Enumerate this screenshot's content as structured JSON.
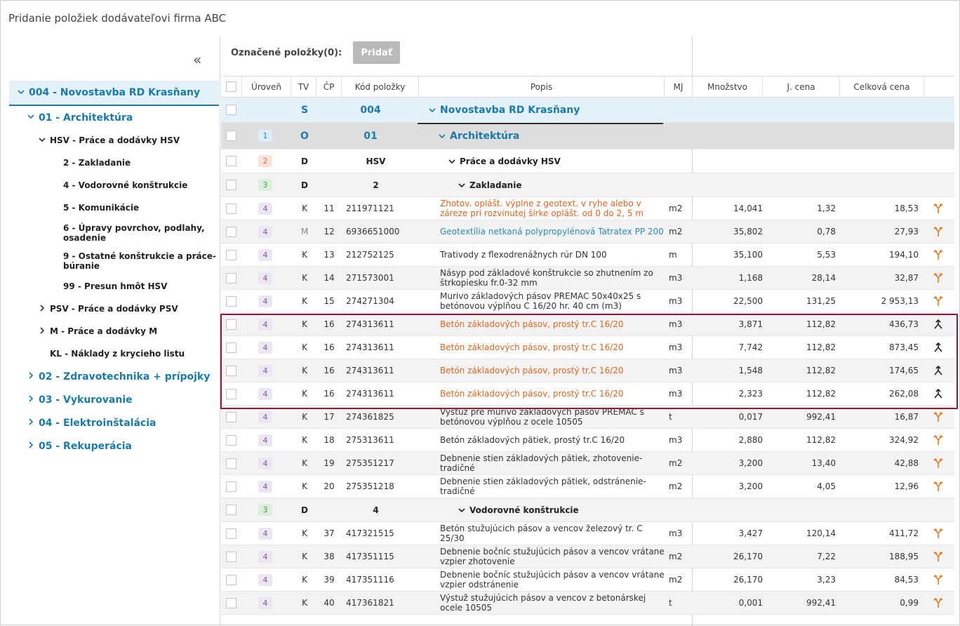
{
  "window_title": "Pridanie položiek dodávateľovi firma ABC",
  "sidebar": {
    "collapse_glyph": "«",
    "tree": [
      {
        "label": "004 - Novostavba RD Krasňany",
        "level": 0,
        "chev": "down"
      },
      {
        "label": "01 - Architektúra",
        "level": 1,
        "chev": "down"
      },
      {
        "label": "HSV - Práce a dodávky HSV",
        "level": 2,
        "chev": "down"
      },
      {
        "label": "2 - Zakladanie",
        "level": 3
      },
      {
        "label": "4 - Vodorovné konštrukcie",
        "level": 3
      },
      {
        "label": "5 - Komunikácie",
        "level": 3
      },
      {
        "label": "6 - Úpravy povrchov, podlahy, osadenie",
        "level": 3,
        "tall": true
      },
      {
        "label": "9 - Ostatné konštrukcie a práce-búranie",
        "level": 3,
        "tall": true
      },
      {
        "label": "99 - Presun hmôt HSV",
        "level": 3
      },
      {
        "label": "PSV - Práce a dodávky PSV",
        "level": 2,
        "chev": "right"
      },
      {
        "label": "M - Práce a dodávky M",
        "level": 2,
        "chev": "right"
      },
      {
        "label": "KL - Náklady z krycieho listu",
        "level": 2
      },
      {
        "label": "02 - Zdravotechnika + prípojky",
        "level": 1,
        "chev": "right"
      },
      {
        "label": "03 - Vykurovanie",
        "level": 1,
        "chev": "right"
      },
      {
        "label": "04 - Elektroinštalácia",
        "level": 1,
        "chev": "right"
      },
      {
        "label": "05 - Rekuperácia",
        "level": 1,
        "chev": "right"
      }
    ]
  },
  "toolbar": {
    "selected_label": "Označené položky(0):",
    "add_label": "Pridať"
  },
  "table": {
    "columns": [
      "Úroveň",
      "TV",
      "ČP",
      "Kód položky",
      "Popis",
      "MJ",
      "Množstvo",
      "J. cena",
      "Celková cena"
    ],
    "rows": [
      {
        "kind": "S",
        "tv": "S",
        "kod": "004",
        "popis": "Novostavba RD Krasňany"
      },
      {
        "kind": "O",
        "lvl": "1",
        "tv": "O",
        "kod": "01",
        "popis": "Architektúra"
      },
      {
        "kind": "D",
        "lvl": "2",
        "tv": "D",
        "kod": "HSV",
        "popis": "Práce a dodávky HSV",
        "indent": 1
      },
      {
        "kind": "D",
        "lvl": "3",
        "tv": "D",
        "kod": "2",
        "popis": "Zakladanie",
        "indent": 2,
        "zebra": true
      },
      {
        "kind": "I",
        "lvl": "4",
        "tv": "K",
        "cp": "11",
        "kod": "211971121",
        "popis": "Zhotov. oplášt. výplne z geotext. v ryhe alebo v záreze pri rozvinutej šírke oplášt. od 0 do 2, 5 m",
        "mj": "m2",
        "mn": "14,041",
        "jc": "1,32",
        "cc": "18,53",
        "color": "orange",
        "icon": "fork"
      },
      {
        "kind": "I",
        "lvl": "4",
        "tv": "M",
        "cp": "12",
        "kod": "6936651000",
        "popis": "Geotextília netkaná polypropylénová Tatratex PP 200",
        "mj": "m2",
        "mn": "35,802",
        "jc": "0,78",
        "cc": "27,93",
        "color": "blue",
        "icon": "fork",
        "zebra": true
      },
      {
        "kind": "I",
        "lvl": "4",
        "tv": "K",
        "cp": "13",
        "kod": "212752125",
        "popis": "Trativody z flexodrenážnych rúr DN 100",
        "mj": "m",
        "mn": "35,100",
        "jc": "5,53",
        "cc": "194,10",
        "icon": "fork"
      },
      {
        "kind": "I",
        "lvl": "4",
        "tv": "K",
        "cp": "14",
        "kod": "271573001",
        "popis": "Násyp pod základové konštrukcie so zhutnením zo štrkopiesku fr.0-32 mm",
        "mj": "m3",
        "mn": "1,168",
        "jc": "28,14",
        "cc": "32,87",
        "icon": "fork",
        "zebra": true
      },
      {
        "kind": "I",
        "lvl": "4",
        "tv": "K",
        "cp": "15",
        "kod": "274271304",
        "popis": "Murivo základových pásov PREMAC 50x40x25 s betónovou výplňou C 16/20 hr. 40 cm (m3)",
        "mj": "m3",
        "mn": "22,500",
        "jc": "131,25",
        "cc": "2 953,13",
        "icon": "fork"
      },
      {
        "kind": "I",
        "lvl": "4",
        "tv": "K",
        "cp": "16",
        "kod": "274313611",
        "popis": "Betón základových pásov, prostý tr.C 16/20",
        "mj": "m3",
        "mn": "3,871",
        "jc": "112,82",
        "cc": "436,73",
        "color": "orange",
        "icon": "merge",
        "zebra": true
      },
      {
        "kind": "I",
        "lvl": "4",
        "tv": "K",
        "cp": "16",
        "kod": "274313611",
        "popis": "Betón základových pásov, prostý tr.C 16/20",
        "mj": "m3",
        "mn": "7,742",
        "jc": "112,82",
        "cc": "873,45",
        "color": "orange",
        "icon": "merge"
      },
      {
        "kind": "I",
        "lvl": "4",
        "tv": "K",
        "cp": "16",
        "kod": "274313611",
        "popis": "Betón základových pásov, prostý tr.C 16/20",
        "mj": "m3",
        "mn": "1,548",
        "jc": "112,82",
        "cc": "174,65",
        "color": "orange",
        "icon": "merge",
        "zebra": true
      },
      {
        "kind": "I",
        "lvl": "4",
        "tv": "K",
        "cp": "16",
        "kod": "274313611",
        "popis": "Betón základových pásov, prostý tr.C 16/20",
        "mj": "m3",
        "mn": "2,323",
        "jc": "112,82",
        "cc": "262,08",
        "color": "orange",
        "icon": "merge"
      },
      {
        "kind": "I",
        "lvl": "4",
        "tv": "K",
        "cp": "17",
        "kod": "274361825",
        "popis": "Výstuž pre murivo základových pásov PREMAC s betónovou výplňou z ocele 10505",
        "mj": "t",
        "mn": "0,017",
        "jc": "992,41",
        "cc": "16,87",
        "icon": "fork",
        "zebra": true
      },
      {
        "kind": "I",
        "lvl": "4",
        "tv": "K",
        "cp": "18",
        "kod": "275313611",
        "popis": "Betón základových pätiek, prostý tr.C 16/20",
        "mj": "m3",
        "mn": "2,880",
        "jc": "112,82",
        "cc": "324,92",
        "icon": "fork"
      },
      {
        "kind": "I",
        "lvl": "4",
        "tv": "K",
        "cp": "19",
        "kod": "275351217",
        "popis": "Debnenie stien základových pätiek, zhotovenie-tradičné",
        "mj": "m2",
        "mn": "3,200",
        "jc": "13,40",
        "cc": "42,88",
        "icon": "fork",
        "zebra": true
      },
      {
        "kind": "I",
        "lvl": "4",
        "tv": "K",
        "cp": "20",
        "kod": "275351218",
        "popis": "Debnenie stien základových pätiek, odstránenie-tradičné",
        "mj": "m2",
        "mn": "3,200",
        "jc": "4,05",
        "cc": "12,96",
        "icon": "fork"
      },
      {
        "kind": "D",
        "lvl": "3",
        "tv": "D",
        "kod": "4",
        "popis": "Vodorovné konštrukcie",
        "indent": 2,
        "zebra": true
      },
      {
        "kind": "I",
        "lvl": "4",
        "tv": "K",
        "cp": "37",
        "kod": "417321515",
        "popis": "Betón stužujúcich pásov a vencov železový tr. C 25/30",
        "mj": "m3",
        "mn": "3,427",
        "jc": "120,14",
        "cc": "411,72",
        "icon": "fork"
      },
      {
        "kind": "I",
        "lvl": "4",
        "tv": "K",
        "cp": "38",
        "kod": "417351115",
        "popis": "Debnenie bočníc stužujúcich pásov a vencov vrátane vzpier zhotovenie",
        "mj": "m2",
        "mn": "26,170",
        "jc": "7,22",
        "cc": "188,95",
        "icon": "fork",
        "zebra": true
      },
      {
        "kind": "I",
        "lvl": "4",
        "tv": "K",
        "cp": "39",
        "kod": "417351116",
        "popis": "Debnenie bočníc stužujúcich pásov a vencov vrátane vzpier odstránenie",
        "mj": "m2",
        "mn": "26,170",
        "jc": "3,23",
        "cc": "84,53",
        "icon": "fork"
      },
      {
        "kind": "I",
        "lvl": "4",
        "tv": "K",
        "cp": "40",
        "kod": "417361821",
        "popis": "Výstuž stužujúcich pásov a vencov z betonárskej ocele 10505",
        "mj": "t",
        "mn": "0,001",
        "jc": "992,41",
        "cc": "0,99",
        "icon": "fork",
        "zebra": true
      }
    ]
  }
}
